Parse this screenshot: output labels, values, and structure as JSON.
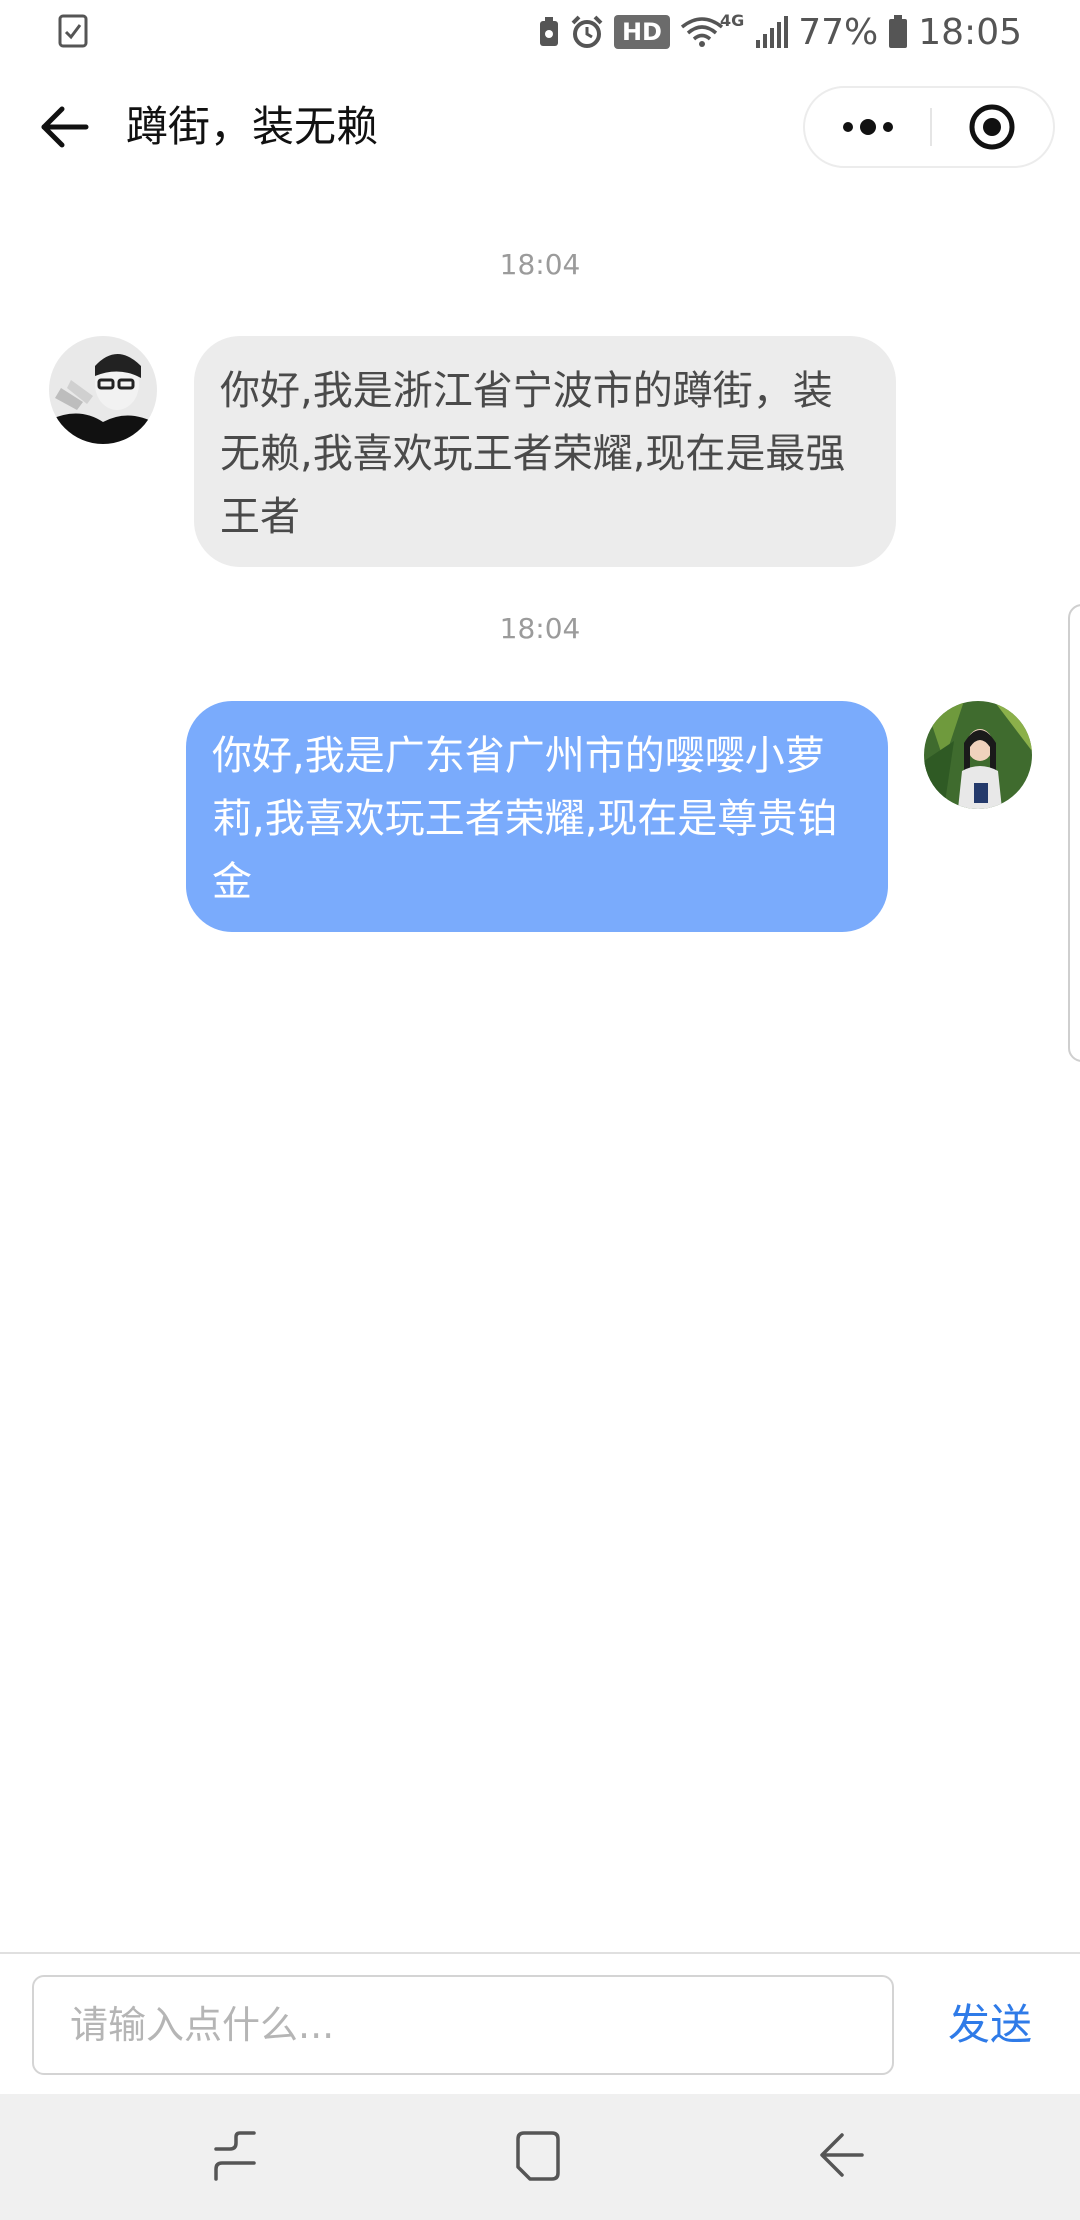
{
  "status_bar": {
    "hd_label": "HD",
    "network_label": "4G",
    "battery_percent": "77%",
    "time": "18:05",
    "icons": [
      "notification-icon",
      "battery-saver-icon",
      "alarm-icon",
      "hd-voice-icon",
      "wifi-icon",
      "signal-icon",
      "battery-icon"
    ]
  },
  "header": {
    "title": "蹲街，装无赖",
    "back_icon": "arrow-left-icon",
    "menu_icon": "more-dots-icon",
    "close_icon": "target-circle-icon"
  },
  "messages": [
    {
      "timestamp": "18:04",
      "direction": "incoming",
      "text": "你好,我是浙江省宁波市的蹲街，装无赖,我喜欢玩王者荣耀,现在是最强王者"
    },
    {
      "timestamp": "18:04",
      "direction": "outgoing",
      "text": "你好,我是广东省广州市的嘤嘤小萝莉,我喜欢玩王者荣耀,现在是尊贵铂金"
    }
  ],
  "input_bar": {
    "placeholder": "请输入点什么...",
    "value": "",
    "send_label": "发送"
  },
  "nav_bar": {
    "icons": [
      "recent-apps-icon",
      "home-icon",
      "back-icon"
    ]
  },
  "colors": {
    "outgoing_bubble": "#7aabfc",
    "incoming_bubble": "#ececec",
    "send_text": "#2f7be8",
    "nav_bar_bg": "#f0f0f0"
  }
}
